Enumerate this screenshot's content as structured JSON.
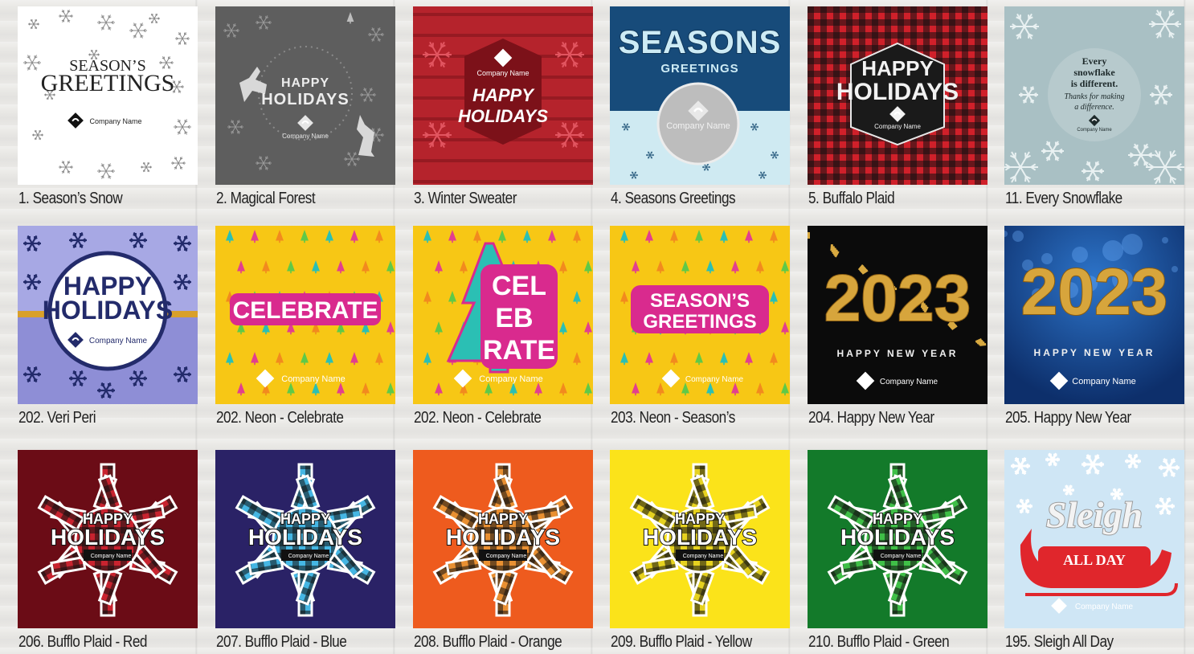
{
  "gallery": {
    "rows": [
      {
        "cards": [
          {
            "caption": "1. Season’s Snow",
            "design": "seasons-snow",
            "bg": "#ffffff",
            "lines": [
              "SEASON’S",
              "GREETINGS"
            ],
            "company": "Company Name"
          },
          {
            "caption": "2. Magical Forest",
            "design": "magical-forest",
            "bg": "#5e5e5e",
            "lines": [
              "HAPPY",
              "HOLIDAYS"
            ],
            "company": "Company Name"
          },
          {
            "caption": "3. Winter Sweater",
            "design": "winter-sweater",
            "bg": "#b5232c",
            "lines": [
              "HAPPY",
              "HOLIDAYS"
            ],
            "company": "Company Name"
          },
          {
            "caption": "4. Seasons Greetings",
            "design": "seasons-greetings",
            "bg": "#174b7a",
            "lines": [
              "SEASONS",
              "GREETINGS"
            ],
            "company": "Company Name"
          },
          {
            "caption": "5. Buffalo Plaid",
            "design": "buffalo-plaid",
            "bg": "#d0202a",
            "lines": [
              "HAPPY",
              "HOLIDAYS"
            ],
            "company": "Company Name"
          },
          {
            "caption": "11. Every Snowflake",
            "design": "every-snowflake",
            "bg": "#a9c0c4",
            "lines": [
              "Every",
              "snowflake",
              "is different.",
              "Thanks for making",
              "a difference."
            ],
            "company": "Company Name"
          }
        ]
      },
      {
        "cards": [
          {
            "caption": "202. Veri Peri",
            "design": "veri-peri",
            "bg": "#8e8ed6",
            "lines": [
              "HAPPY",
              "HOLIDAYS"
            ],
            "company": "Company Name"
          },
          {
            "caption": "202. Neon - Celebrate",
            "design": "neon-celebrate",
            "bg": "#f7c715",
            "lines": [
              "CELEBRATE"
            ],
            "company": "Company Name"
          },
          {
            "caption": "202. Neon - Celebrate",
            "design": "neon-celebrate-tree",
            "bg": "#f7c715",
            "lines": [
              "CEL",
              "EB",
              "RATE"
            ],
            "company": "Company Name"
          },
          {
            "caption": "203. Neon - Season’s",
            "design": "neon-seasons",
            "bg": "#f7c715",
            "lines": [
              "SEASON’S",
              "GREETINGS"
            ],
            "company": "Company Name"
          },
          {
            "caption": "204. Happy New Year",
            "design": "new-year-black",
            "bg": "#0b0b0b",
            "lines": [
              "2023",
              "HAPPY NEW YEAR"
            ],
            "company": "Company Name"
          },
          {
            "caption": "205. Happy New Year",
            "design": "new-year-blue",
            "bg": "#0d2f6b",
            "lines": [
              "2023",
              "HAPPY NEW YEAR"
            ],
            "company": "Company Name"
          }
        ]
      },
      {
        "cards": [
          {
            "caption": "206. Bufflo Plaid - Red",
            "design": "plaid-snowflake",
            "bg": "#6b0c16",
            "plaid": "#c8232f",
            "lines": [
              "HAPPY",
              "HOLIDAYS"
            ],
            "company": "Company Name"
          },
          {
            "caption": "207. Bufflo Plaid - Blue",
            "design": "plaid-snowflake",
            "bg": "#2a2266",
            "plaid": "#45b6e3",
            "lines": [
              "HAPPY",
              "HOLIDAYS"
            ],
            "company": "Company Name"
          },
          {
            "caption": "208. Bufflo Plaid - Orange",
            "design": "plaid-snowflake",
            "bg": "#ee5b1e",
            "plaid": "#e99032",
            "lines": [
              "HAPPY",
              "HOLIDAYS"
            ],
            "company": "Company Name"
          },
          {
            "caption": "209. Bufflo Plaid - Yellow",
            "design": "plaid-snowflake",
            "bg": "#fbe31a",
            "plaid": "#e6d21f",
            "lines": [
              "HAPPY",
              "HOLIDAYS"
            ],
            "company": "Company Name"
          },
          {
            "caption": "210. Bufflo Plaid - Green",
            "design": "plaid-snowflake",
            "bg": "#137a2a",
            "plaid": "#3fbf47",
            "lines": [
              "HAPPY",
              "HOLIDAYS"
            ],
            "company": "Company Name"
          },
          {
            "caption": "195. Sleigh All Day",
            "design": "sleigh-all-day",
            "bg": "#cfe6f5",
            "lines": [
              "Sleigh",
              "ALL DAY"
            ],
            "company": "Company Name"
          }
        ]
      }
    ]
  }
}
